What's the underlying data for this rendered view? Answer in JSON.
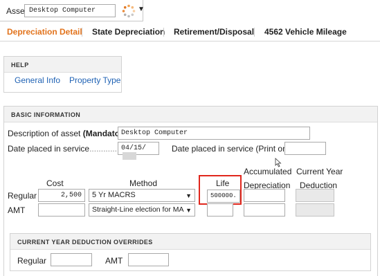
{
  "asset": {
    "label": "Asset ...",
    "value": "Desktop Computer"
  },
  "tabs": [
    {
      "label": "Depreciation Detail",
      "active": true
    },
    {
      "label": "State Depreciation",
      "active": false
    },
    {
      "label": "Retirement/Disposal",
      "active": false
    },
    {
      "label": "4562 Vehicle Mileage",
      "active": false
    }
  ],
  "help": {
    "title": "HELP",
    "links": [
      "General Info",
      "Property Type"
    ]
  },
  "basic": {
    "title": "BASIC INFORMATION",
    "description_label_pre": "Description of asset ",
    "description_label_bold": "(Mandatory)",
    "description_value": "Desktop Computer",
    "date_label": "Date placed in service",
    "date_value": "04/15/",
    "date_print_label": "Date placed in service (Print only)",
    "date_print_value": "",
    "columns": {
      "cost": "Cost",
      "method": "Method",
      "life": "Life",
      "accum_top": "Accumulated",
      "accum_bottom": "Depreciation",
      "current_top": "Current Year",
      "current_bottom": "Deduction"
    },
    "rows": {
      "regular_label": "Regular",
      "regular_cost": "2,500",
      "regular_method": "5 Yr MACRS",
      "regular_life": "500000.",
      "amt_label": "AMT",
      "amt_cost": "",
      "amt_method": "Straight-Line election for MACI",
      "amt_life": ""
    }
  },
  "overrides": {
    "title": "CURRENT YEAR DEDUCTION OVERRIDES",
    "regular_label": "Regular",
    "amt_label": "AMT"
  },
  "colors": {
    "accent": "#e2731c",
    "link": "#1f62b4",
    "highlight": "#e0261c"
  }
}
